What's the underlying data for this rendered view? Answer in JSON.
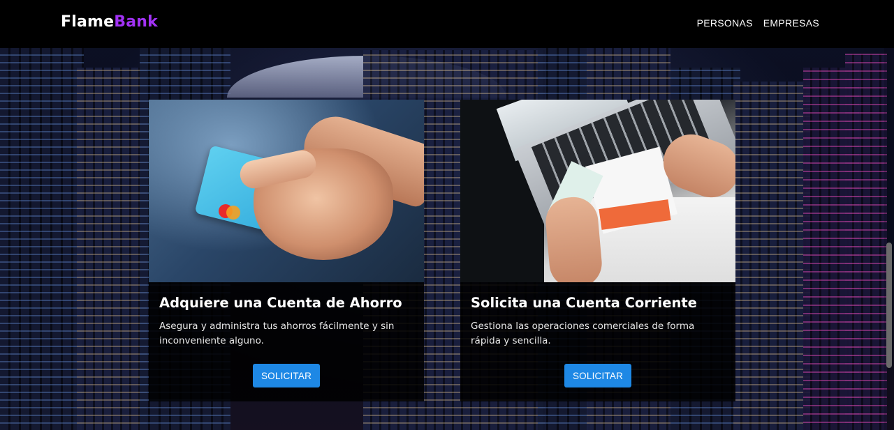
{
  "brand": {
    "part1": "Flame",
    "part2": "Bank"
  },
  "nav": {
    "items": [
      "PERSONAS",
      "EMPRESAS"
    ]
  },
  "cards": [
    {
      "title": "Adquiere una Cuenta de Ahorro",
      "text": "Asegura y administra tus ahorros fácilmente y sin inconveniente alguno.",
      "button": "SOLICITAR"
    },
    {
      "title": "Solicita una Cuenta Corriente",
      "text": "Gestiona las operaciones comerciales de forma rápida y sencilla.",
      "button": "SOLICITAR"
    }
  ],
  "colors": {
    "navbar": "#000000",
    "brand_accent": "#a232f5",
    "button": "#1e88e5",
    "card_bg": "rgba(0,0,0,0.88)"
  }
}
